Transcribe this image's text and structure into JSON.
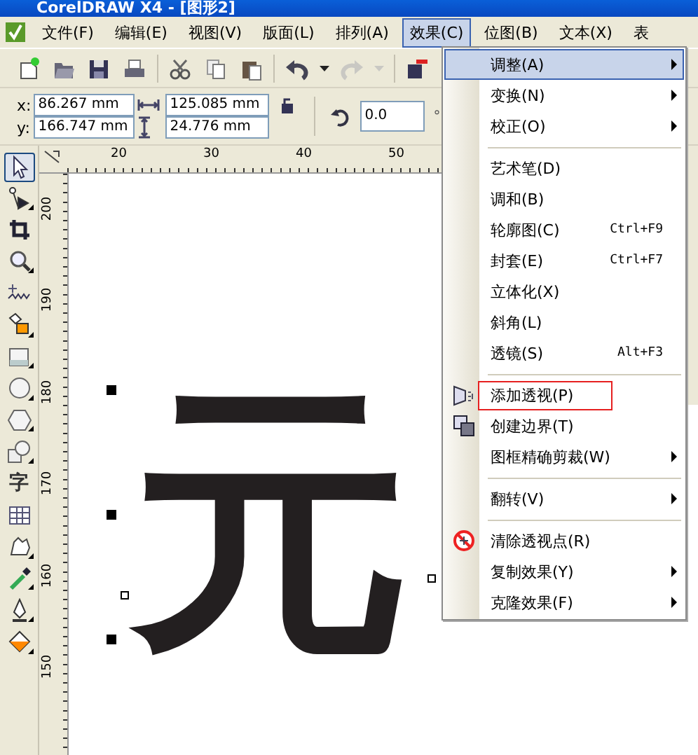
{
  "window": {
    "title": "CorelDRAW X4 - [图形2]"
  },
  "menu_bar": [
    {
      "label": "文件(F)",
      "selected": false
    },
    {
      "label": "编辑(E)",
      "selected": false
    },
    {
      "label": "视图(V)",
      "selected": false
    },
    {
      "label": "版面(L)",
      "selected": false
    },
    {
      "label": "排列(A)",
      "selected": false
    },
    {
      "label": "效果(C)",
      "selected": true
    },
    {
      "label": "位图(B)",
      "selected": false
    },
    {
      "label": "文本(X)",
      "selected": false
    },
    {
      "label": "表",
      "selected": false
    }
  ],
  "toolbar": [
    {
      "disabled": false
    },
    {
      "disabled": false
    },
    {
      "disabled": false
    },
    {
      "disabled": false
    },
    {
      "disabled": false
    },
    {
      "disabled": false
    },
    {
      "disabled": false
    },
    {
      "disabled": false
    },
    {
      "disabled": false
    },
    {
      "disabled": true
    },
    {
      "disabled": true
    },
    {
      "disabled": false
    }
  ],
  "property_bar": {
    "x_label": "x:",
    "x_value": "86.267 mm",
    "y_label": "y:",
    "y_value": "166.747 mm",
    "width_value": "125.085 mm",
    "height_value": "24.776 mm",
    "angle_value": "0.0",
    "degree_mark": "°"
  },
  "horizontal_ruler": [
    "20",
    "30",
    "40",
    "50"
  ],
  "vertical_ruler": [
    "200",
    "190",
    "180",
    "170",
    "160",
    "150"
  ],
  "toolbox": [
    {
      "selected": true
    },
    {
      "selected": false
    },
    {
      "selected": false
    },
    {
      "selected": false
    },
    {
      "selected": false
    },
    {
      "selected": false
    },
    {
      "selected": false
    },
    {
      "selected": false
    },
    {
      "selected": false
    },
    {
      "selected": false
    },
    {
      "selected": false,
      "glyph": "字"
    },
    {
      "selected": false
    },
    {
      "selected": false
    },
    {
      "selected": false
    },
    {
      "selected": false
    },
    {
      "selected": false
    }
  ],
  "canvas": {
    "artwork_text": "元"
  },
  "effects_menu": [
    {
      "kind": "command",
      "label": "调整(A)",
      "submenu": true,
      "selected": true,
      "annotated": false
    },
    {
      "kind": "command",
      "label": "变换(N)",
      "submenu": true,
      "selected": false,
      "annotated": false
    },
    {
      "kind": "command",
      "label": "校正(O)",
      "submenu": true,
      "selected": false,
      "annotated": false
    },
    {
      "kind": "separator"
    },
    {
      "kind": "command",
      "label": "艺术笔(D)",
      "submenu": false,
      "selected": false,
      "annotated": false
    },
    {
      "kind": "command",
      "label": "调和(B)",
      "submenu": false,
      "selected": false,
      "annotated": false
    },
    {
      "kind": "command",
      "label": "轮廓图(C)",
      "shortcut": "Ctrl+F9",
      "submenu": false,
      "selected": false,
      "annotated": false
    },
    {
      "kind": "command",
      "label": "封套(E)",
      "shortcut": "Ctrl+F7",
      "submenu": false,
      "selected": false,
      "annotated": false
    },
    {
      "kind": "command",
      "label": "立体化(X)",
      "submenu": false,
      "selected": false,
      "annotated": false
    },
    {
      "kind": "command",
      "label": "斜角(L)",
      "submenu": false,
      "selected": false,
      "annotated": false
    },
    {
      "kind": "command",
      "label": "透镜(S)",
      "shortcut": "Alt+F3",
      "submenu": false,
      "selected": false,
      "annotated": false
    },
    {
      "kind": "separator"
    },
    {
      "kind": "command",
      "label": "添加透视(P)",
      "submenu": false,
      "selected": false,
      "annotated": true
    },
    {
      "kind": "command",
      "label": "创建边界(T)",
      "submenu": false,
      "selected": false,
      "annotated": false
    },
    {
      "kind": "command",
      "label": "图框精确剪裁(W)",
      "submenu": true,
      "selected": false,
      "annotated": false
    },
    {
      "kind": "separator"
    },
    {
      "kind": "command",
      "label": "翻转(V)",
      "submenu": true,
      "selected": false,
      "annotated": false
    },
    {
      "kind": "separator"
    },
    {
      "kind": "command",
      "label": "清除透视点(R)",
      "submenu": false,
      "selected": false,
      "annotated": false
    },
    {
      "kind": "command",
      "label": "复制效果(Y)",
      "submenu": true,
      "selected": false,
      "annotated": false
    },
    {
      "kind": "command",
      "label": "克隆效果(F)",
      "submenu": true,
      "selected": false,
      "annotated": false
    }
  ]
}
